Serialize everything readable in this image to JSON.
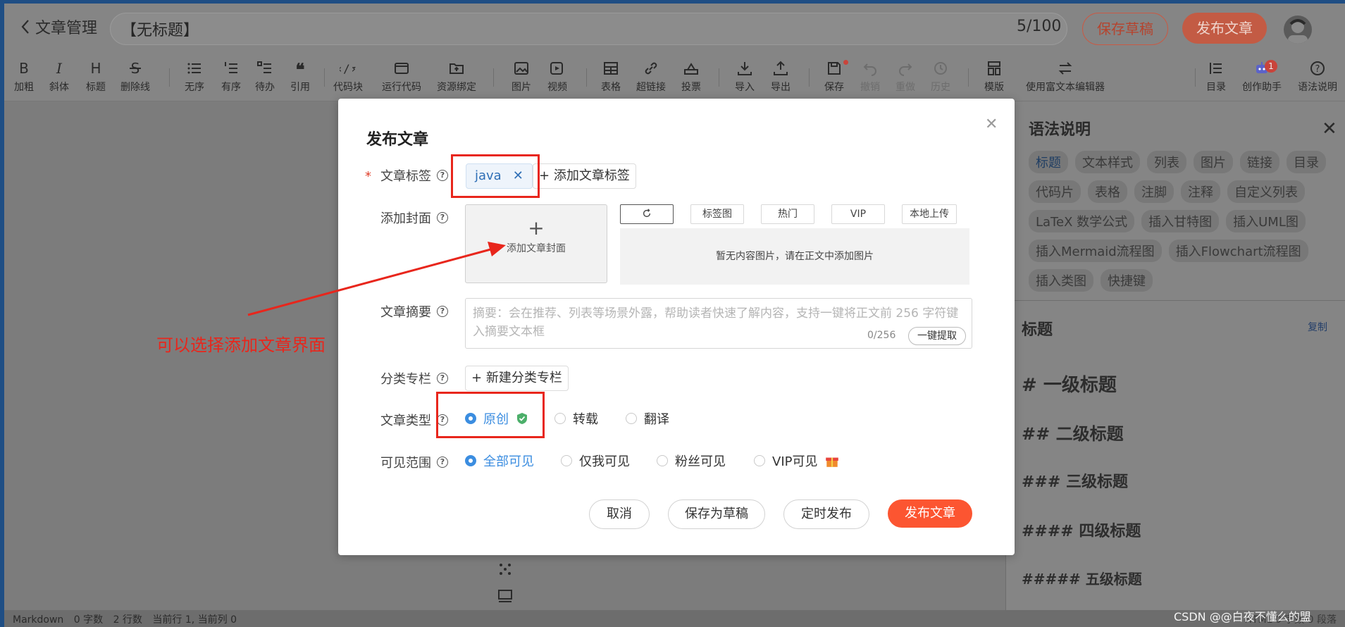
{
  "header": {
    "back_label": "文章管理",
    "title_value": "【无标题】",
    "title_count": "5/100",
    "save_draft": "保存草稿",
    "publish": "发布文章"
  },
  "toolbar": {
    "items": [
      {
        "label": "加粗",
        "icon": "bold-icon"
      },
      {
        "label": "斜体",
        "icon": "italic-icon"
      },
      {
        "label": "标题",
        "icon": "heading-icon"
      },
      {
        "label": "删除线",
        "icon": "strikethrough-icon"
      },
      {
        "label": "无序",
        "icon": "unordered-list-icon"
      },
      {
        "label": "有序",
        "icon": "ordered-list-icon"
      },
      {
        "label": "待办",
        "icon": "todo-list-icon"
      },
      {
        "label": "引用",
        "icon": "quote-icon"
      },
      {
        "label": "代码块",
        "icon": "code-block-icon"
      },
      {
        "label": "运行代码",
        "icon": "run-code-icon"
      },
      {
        "label": "资源绑定",
        "icon": "resource-bind-icon"
      },
      {
        "label": "图片",
        "icon": "image-icon"
      },
      {
        "label": "视频",
        "icon": "video-icon"
      },
      {
        "label": "表格",
        "icon": "table-icon"
      },
      {
        "label": "超链接",
        "icon": "link-icon"
      },
      {
        "label": "投票",
        "icon": "vote-icon"
      },
      {
        "label": "导入",
        "icon": "import-icon"
      },
      {
        "label": "导出",
        "icon": "export-icon"
      },
      {
        "label": "保存",
        "icon": "save-icon"
      },
      {
        "label": "撤销",
        "icon": "undo-icon"
      },
      {
        "label": "重做",
        "icon": "redo-icon"
      },
      {
        "label": "历史",
        "icon": "history-icon"
      },
      {
        "label": "模版",
        "icon": "template-icon"
      },
      {
        "label": "使用富文本编辑器",
        "icon": "switch-editor-icon"
      },
      {
        "label": "目录",
        "icon": "toc-icon"
      },
      {
        "label": "创作助手",
        "icon": "assistant-icon",
        "badge": "1"
      },
      {
        "label": "语法说明",
        "icon": "help-icon"
      }
    ]
  },
  "syntax_panel": {
    "title": "语法说明",
    "chips": [
      "标题",
      "文本样式",
      "列表",
      "图片",
      "链接",
      "目录",
      "代码片",
      "表格",
      "注脚",
      "注释",
      "自定义列表",
      "LaTeX 数学公式",
      "插入甘特图",
      "插入UML图",
      "插入Mermaid流程图",
      "插入Flowchart流程图",
      "插入类图",
      "快捷键"
    ],
    "section_title": "标题",
    "copy": "复制",
    "headings": [
      "# 一级标题",
      "## 二级标题",
      "### 三级标题",
      "#### 四级标题",
      "##### 五级标题"
    ]
  },
  "statusbar": {
    "mode": "Markdown",
    "chars": "0 字数",
    "lines": "2 行数",
    "position": "当前行 1, 当前列 0",
    "right": "HTML 0 字数 0 段落"
  },
  "watermark": "CSDN @@白夜不懂么的盟",
  "modal": {
    "title": "发布文章",
    "tags_label": "文章标签",
    "tag_value": "java",
    "add_tag": "添加文章标签",
    "cover_label": "添加封面",
    "cover_upload": "添加文章封面",
    "cover_tabs": [
      "标签图",
      "热门",
      "VIP",
      "本地上传"
    ],
    "cover_empty": "暂无内容图片，请在正文中添加图片",
    "summary_label": "文章摘要",
    "summary_placeholder": "摘要：会在推荐、列表等场景外露，帮助读者快速了解内容，支持一键将正文前 256 字符键入摘要文本框",
    "summary_count": "0/256",
    "summary_extract": "一键提取",
    "category_label": "分类专栏",
    "new_category": "新建分类专栏",
    "type_label": "文章类型",
    "types": [
      "原创",
      "转载",
      "翻译"
    ],
    "type_selected": "原创",
    "visibility_label": "可见范围",
    "visibility": [
      "全部可见",
      "仅我可见",
      "粉丝可见",
      "VIP可见"
    ],
    "visibility_selected": "全部可见",
    "cancel": "取消",
    "save_draft": "保存为草稿",
    "schedule": "定时发布",
    "publish": "发布文章"
  },
  "annotation": {
    "text": "可以选择添加文章界面",
    "color": "#e8261c"
  },
  "colors": {
    "accent": "#fc5531",
    "link_blue": "#3b8de0"
  }
}
